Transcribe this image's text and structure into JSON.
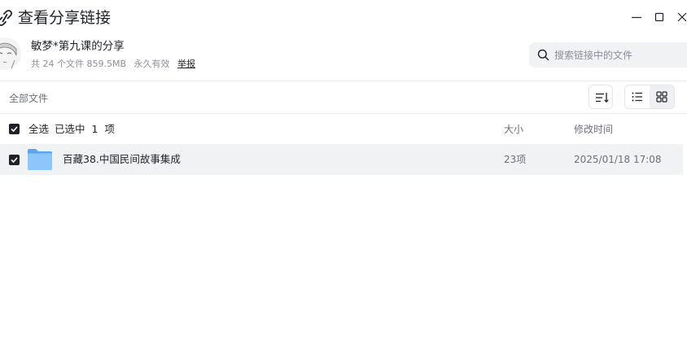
{
  "window": {
    "title": "查看分享链接"
  },
  "share": {
    "name": "敏梦*第九课的分享",
    "meta_count": "共 24 个文件 859.5MB",
    "meta_validity": "永久有效",
    "report_label": "举报"
  },
  "search": {
    "placeholder": "搜索链接中的文件"
  },
  "toolbar": {
    "breadcrumb": "全部文件"
  },
  "table": {
    "select_all_label": "全选",
    "selected_text": "已选中  1  项",
    "columns": {
      "size": "大小",
      "modified": "修改时间"
    },
    "rows": [
      {
        "name": "百藏38.中国民间故事集成",
        "size": "23项",
        "modified": "2025/01/18 17:08",
        "icon": "folder-icon",
        "checked": true
      }
    ]
  },
  "colors": {
    "row_selected_bg": "#f1f2f4",
    "checkbox": "#1f2329",
    "folder": "#6fb3f7"
  }
}
